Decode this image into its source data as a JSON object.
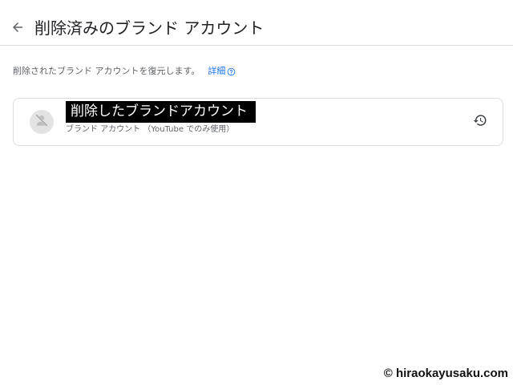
{
  "header": {
    "back_icon": "arrow-back-icon",
    "title": "削除済みのブランド アカウント"
  },
  "description": {
    "text": "削除されたブランド アカウントを復元します。",
    "details_link": "詳細",
    "help_icon": "help-circle-icon"
  },
  "account": {
    "name": "削除したブランドアカウント",
    "type": "ブランド アカウント （YouTube でのみ使用）",
    "avatar_icon": "person-off-icon",
    "restore_icon": "restore-history-icon"
  },
  "watermark": {
    "text": "© hiraokayusaku.com"
  },
  "colors": {
    "link": "#1a73e8",
    "border": "#dadce0",
    "secondary_text": "#5f6368"
  }
}
